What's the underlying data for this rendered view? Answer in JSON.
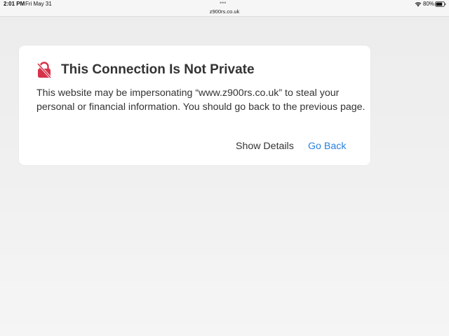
{
  "status_bar": {
    "time": "2:01 PM",
    "date": "Fri May 31",
    "dots": "•••",
    "url": "z900rs.co.uk",
    "battery_percent": "80%"
  },
  "warning": {
    "title": "This Connection Is Not Private",
    "message": "This website may be impersonating “www.z900rs.co.uk” to steal your personal or financial information. You should go back to the previous page.",
    "show_details_label": "Show Details",
    "go_back_label": "Go Back"
  },
  "colors": {
    "link": "#2a82e0",
    "warning_icon": "#d6334a",
    "text": "#333333"
  }
}
